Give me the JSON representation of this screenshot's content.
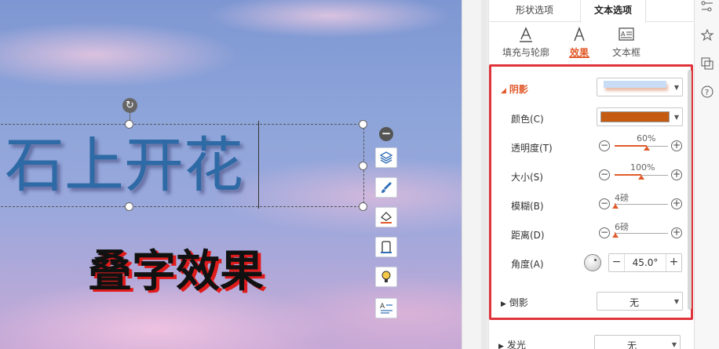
{
  "canvas": {
    "title_text": "石上开花",
    "subtitle_text": "叠字效果"
  },
  "float_tools": {
    "collapse": "−",
    "buttons": [
      "layers-icon",
      "brush-icon",
      "fill-icon",
      "frame-icon",
      "bulb-icon",
      "text-wrap-icon"
    ]
  },
  "panel": {
    "top_tabs": [
      "形状选项",
      "文本选项"
    ],
    "active_top_tab": "文本选项",
    "sub_tabs": [
      {
        "label": "填充与轮廓",
        "icon": "text-fill-icon"
      },
      {
        "label": "效果",
        "icon": "text-effect-icon"
      },
      {
        "label": "文本框",
        "icon": "textbox-icon"
      }
    ],
    "active_sub_tab": "效果",
    "shadow": {
      "heading": "阴影",
      "color_label": "颜色(C)",
      "color_value": "#c55a11",
      "transparency_label": "透明度(T)",
      "transparency_value": "60%",
      "transparency_fraction": 0.6,
      "size_label": "大小(S)",
      "size_value": "100%",
      "size_fraction": 0.5,
      "blur_label": "模糊(B)",
      "blur_value": "4磅",
      "blur_fraction": 0.02,
      "distance_label": "距离(D)",
      "distance_value": "6磅",
      "distance_fraction": 0.02,
      "angle_label": "角度(A)",
      "angle_value": "45.0°"
    },
    "reflection": {
      "heading": "倒影",
      "value": "无"
    },
    "glow": {
      "heading": "发光",
      "value": "无"
    }
  },
  "colors": {
    "accent": "#e15a2b",
    "highlight_border": "#e0343c",
    "title_text": "#2e6aa5"
  }
}
